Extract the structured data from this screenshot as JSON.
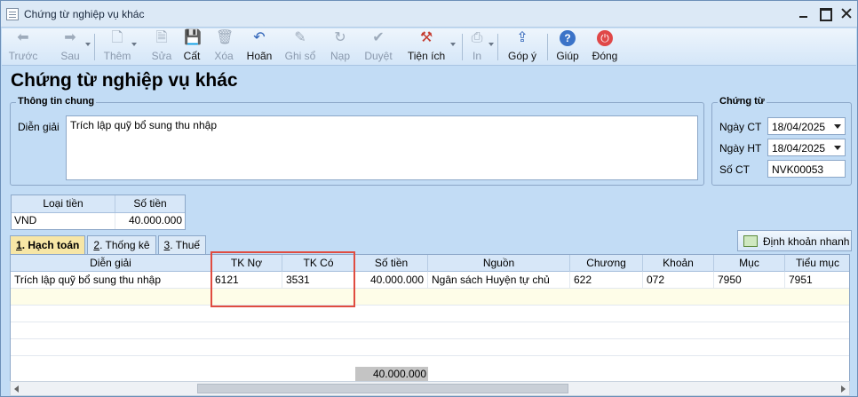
{
  "window": {
    "title": "Chứng từ nghiệp vụ khác"
  },
  "toolbar": {
    "prev": "Trước",
    "next": "Sau",
    "add": "Thêm",
    "edit": "Sửa",
    "save": "Cất",
    "delete": "Xóa",
    "undo": "Hoãn",
    "post": "Ghi sổ",
    "reload": "Nạp",
    "approve": "Duyệt",
    "utilities": "Tiện ích",
    "print": "In",
    "feedback": "Góp ý",
    "help": "Giúp",
    "close": "Đóng"
  },
  "heading": "Chứng từ nghiệp vụ khác",
  "general": {
    "title": "Thông tin chung",
    "description_label": "Diễn giải",
    "description": "Trích lập quỹ bổ sung thu nhập"
  },
  "voucher": {
    "title": "Chứng từ",
    "voucher_date_label": "Ngày CT",
    "voucher_date": "18/04/2025",
    "posting_date_label": "Ngày HT",
    "posting_date": "18/04/2025",
    "number_label": "Số CT",
    "number": "NVK00053"
  },
  "currency": {
    "header_type": "Loại tiền",
    "header_amount": "Số tiền",
    "type": "VND",
    "amount": "40.000.000"
  },
  "tabs": [
    {
      "num": "1",
      "label": ". Hạch toán"
    },
    {
      "num": "2",
      "label": ". Thống kê"
    },
    {
      "num": "3",
      "label": ". Thuế"
    }
  ],
  "quick_entry_label": "Định khoản nhanh",
  "grid": {
    "columns": [
      "Diễn giải",
      "TK Nợ",
      "TK Có",
      "Số tiền",
      "Nguồn",
      "Chương",
      "Khoản",
      "Mục",
      "Tiểu mục"
    ],
    "rows": [
      [
        "Trích lập quỹ bổ sung thu nhập",
        "6121",
        "3531",
        "40.000.000",
        "Ngân sách Huyện tự chủ",
        "622",
        "072",
        "7950",
        "7951"
      ]
    ],
    "total": "40.000.000"
  }
}
